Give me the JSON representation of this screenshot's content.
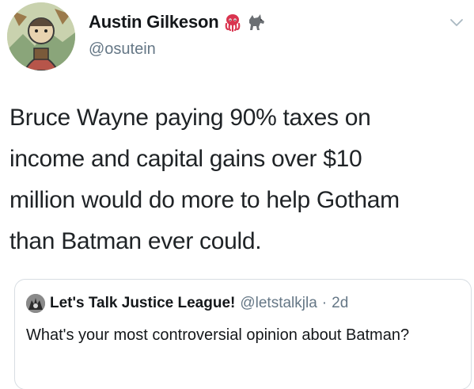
{
  "tweet": {
    "author": {
      "display_name": "Austin Gilkeson",
      "handle": "@osutein",
      "badges": [
        "octopus-emoji",
        "wolf-emoji"
      ]
    },
    "text_lines": [
      "Bruce Wayne paying 90% taxes on",
      "income and capital gains over $10",
      "million would do more to help Gotham",
      "than Batman ever could."
    ],
    "menu_icon": "chevron-down-icon",
    "quoted": {
      "display_name": "Let's Talk Justice League!",
      "handle": "@letstalkjla",
      "separator": "·",
      "time": "2d",
      "text": "What's your most controversial opinion about Batman?"
    }
  },
  "colors": {
    "text": "#14171a",
    "secondary": "#657786",
    "border": "#d7dde2",
    "emoji_octopus": "#e0245e"
  }
}
